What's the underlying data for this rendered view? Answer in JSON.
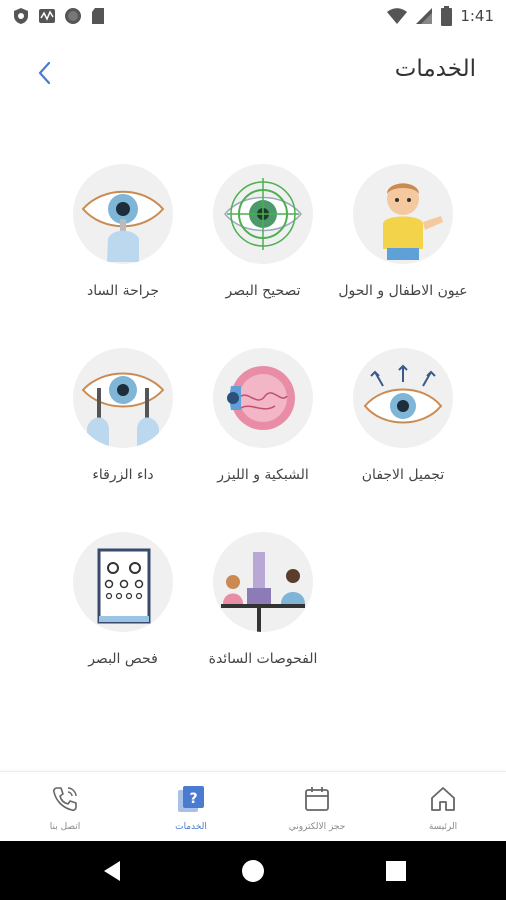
{
  "status_bar": {
    "time": "1:41",
    "left_icons": [
      "shield-icon",
      "activity-icon",
      "circle-icon",
      "sd-card-icon"
    ],
    "right_icons": [
      "wifi-icon",
      "signal-icon",
      "battery-icon"
    ]
  },
  "header": {
    "title": "الخدمات",
    "back_icon": "chevron-left-icon"
  },
  "services": [
    {
      "label": "عيون الاطفال و الحول",
      "icon": "child-eye-icon"
    },
    {
      "label": "تصحيح البصر",
      "icon": "vision-correction-icon"
    },
    {
      "label": "جراحة الساد",
      "icon": "cataract-surgery-icon"
    },
    {
      "label": "تجميل الاجفان",
      "icon": "eyelid-cosmetic-icon"
    },
    {
      "label": "الشبكية و الليزر",
      "icon": "retina-laser-icon"
    },
    {
      "label": "داء الزرقاء",
      "icon": "glaucoma-icon"
    },
    {
      "label": "الفحوصات السائدة",
      "icon": "eye-exam-icon"
    },
    {
      "label": "فحص البصر",
      "icon": "eye-chart-icon"
    }
  ],
  "bottom_nav": {
    "items": [
      {
        "label": "الرئيسة",
        "icon": "home-icon"
      },
      {
        "label": "حجز الالكتروني",
        "icon": "calendar-icon"
      },
      {
        "label": "الخدمات",
        "icon": "services-icon",
        "active": true
      },
      {
        "label": "اتصل بنا",
        "icon": "phone-icon"
      }
    ]
  },
  "colors": {
    "accent": "#4a7bd0",
    "circle_bg": "#f0f0f0",
    "text": "#444444"
  }
}
